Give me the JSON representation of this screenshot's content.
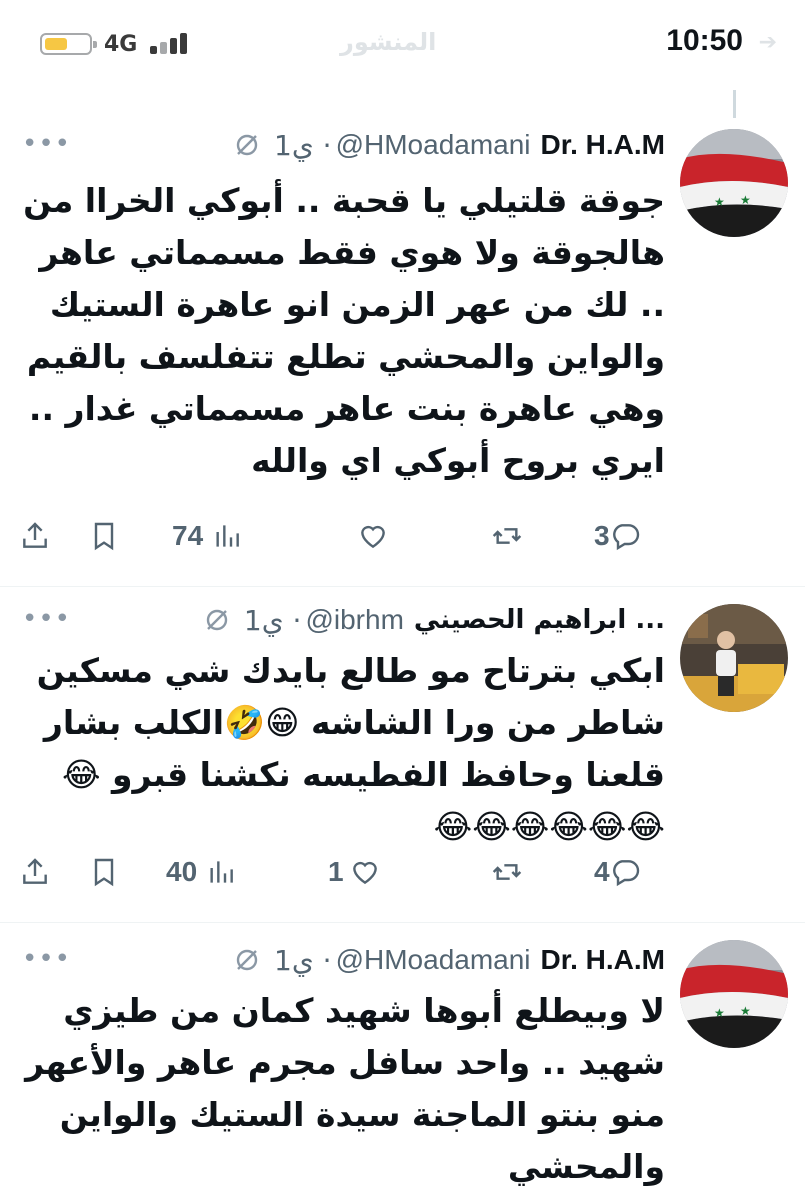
{
  "status_bar": {
    "network": "4G",
    "time": "10:50",
    "faded_title": "المنشور"
  },
  "tweets": [
    {
      "name": "Dr. H.A.M",
      "handle": "@HMoadamani",
      "time": "1ي ·",
      "text": "جوقة قلتيلي يا قحبة .. أبوكي الخراا من هالجوقة ولا هوي فقط مسمماتي عاهر .. لك من عهر الزمن انو عاهرة الستيك والواين والمحشي تطلع تتفلسف بالقيم وهي عاهرة بنت عاهر مسمماتي غدار .. ايري بروح أبوكي اي والله",
      "replies": "3",
      "retweets": "",
      "likes": "",
      "views": "74"
    },
    {
      "name": "ابراهيم الحصيني ...",
      "handle": "@ibrhm",
      "time": "1ي ·",
      "text": "ابكي بترتاح مو طالع بايدك شي مسكين شاطر من ورا الشاشه 😁🤣الكلب بشار قلعنا وحافظ الفطيسه نكشنا قبرو 😂 😂😂😂😂😂😂",
      "replies": "4",
      "retweets": "",
      "likes": "1",
      "views": "40"
    },
    {
      "name": "Dr. H.A.M",
      "handle": "@HMoadamani",
      "time": "1ي ·",
      "text": "لا وبيطلع أبوها شهيد كمان من طيزي شهيد .. واحد سافل مجرم عاهر والأعهر منو بنتو الماجنة سيدة الستيك والواين والمحشي",
      "replies": "",
      "retweets": "",
      "likes": "",
      "views": ""
    }
  ],
  "icons": {
    "more": "more-icon",
    "grok": "grok-icon",
    "reply": "reply-icon",
    "retweet": "retweet-icon",
    "like": "like-icon",
    "views": "views-icon",
    "bookmark": "bookmark-icon",
    "share": "share-icon"
  },
  "colors": {
    "text": "#0f1419",
    "secondary": "#536471",
    "battery": "#f6c744",
    "divider": "#eff3f4"
  }
}
